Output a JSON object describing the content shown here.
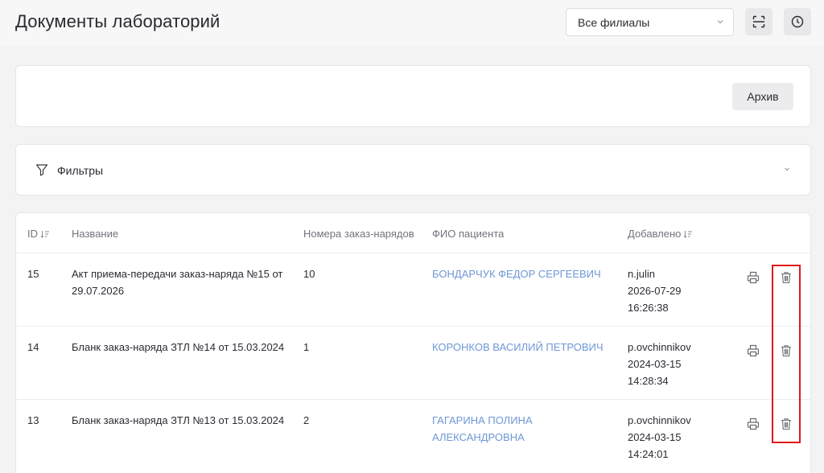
{
  "header": {
    "title": "Документы лабораторий",
    "branch_select": {
      "value": "Все филиалы"
    },
    "scan_icon": "scan-icon",
    "history_icon": "clock-icon"
  },
  "toolbar": {
    "archive_label": "Архив"
  },
  "filters": {
    "label": "Фильтры",
    "icon": "funnel-icon"
  },
  "table": {
    "columns": {
      "id": "ID",
      "name": "Название",
      "orders": "Номера заказ-нарядов",
      "patient": "ФИО пациента",
      "added": "Добавлено"
    },
    "rows": [
      {
        "id": "15",
        "name_line1": "Акт приема-передачи заказ-наряда №15 от",
        "name_line2": "29.07.2026",
        "orders": "10",
        "patient_line1": "БОНДАРЧУК ФЕДОР СЕРГЕЕВИЧ",
        "patient_line2": "",
        "user": "n.julin",
        "date": "2026-07-29",
        "time": "16:26:38"
      },
      {
        "id": "14",
        "name_line1": "Бланк заказ-наряда ЗТЛ №14 от 15.03.2024",
        "name_line2": "",
        "orders": "1",
        "patient_line1": "КОРОНКОВ ВАСИЛИЙ ПЕТРОВИЧ",
        "patient_line2": "",
        "user": "p.ovchinnikov",
        "date": "2024-03-15",
        "time": "14:28:34"
      },
      {
        "id": "13",
        "name_line1": "Бланк заказ-наряда ЗТЛ №13 от 15.03.2024",
        "name_line2": "",
        "orders": "2",
        "patient_line1": "ГАГАРИНА ПОЛИНА",
        "patient_line2": "АЛЕКСАНДРОВНА",
        "user": "p.ovchinnikov",
        "date": "2024-03-15",
        "time": "14:24:01"
      }
    ]
  },
  "colors": {
    "patient_link": "#6f97d6",
    "highlight_border": "#e0191b",
    "background": "#f3f3f4"
  }
}
